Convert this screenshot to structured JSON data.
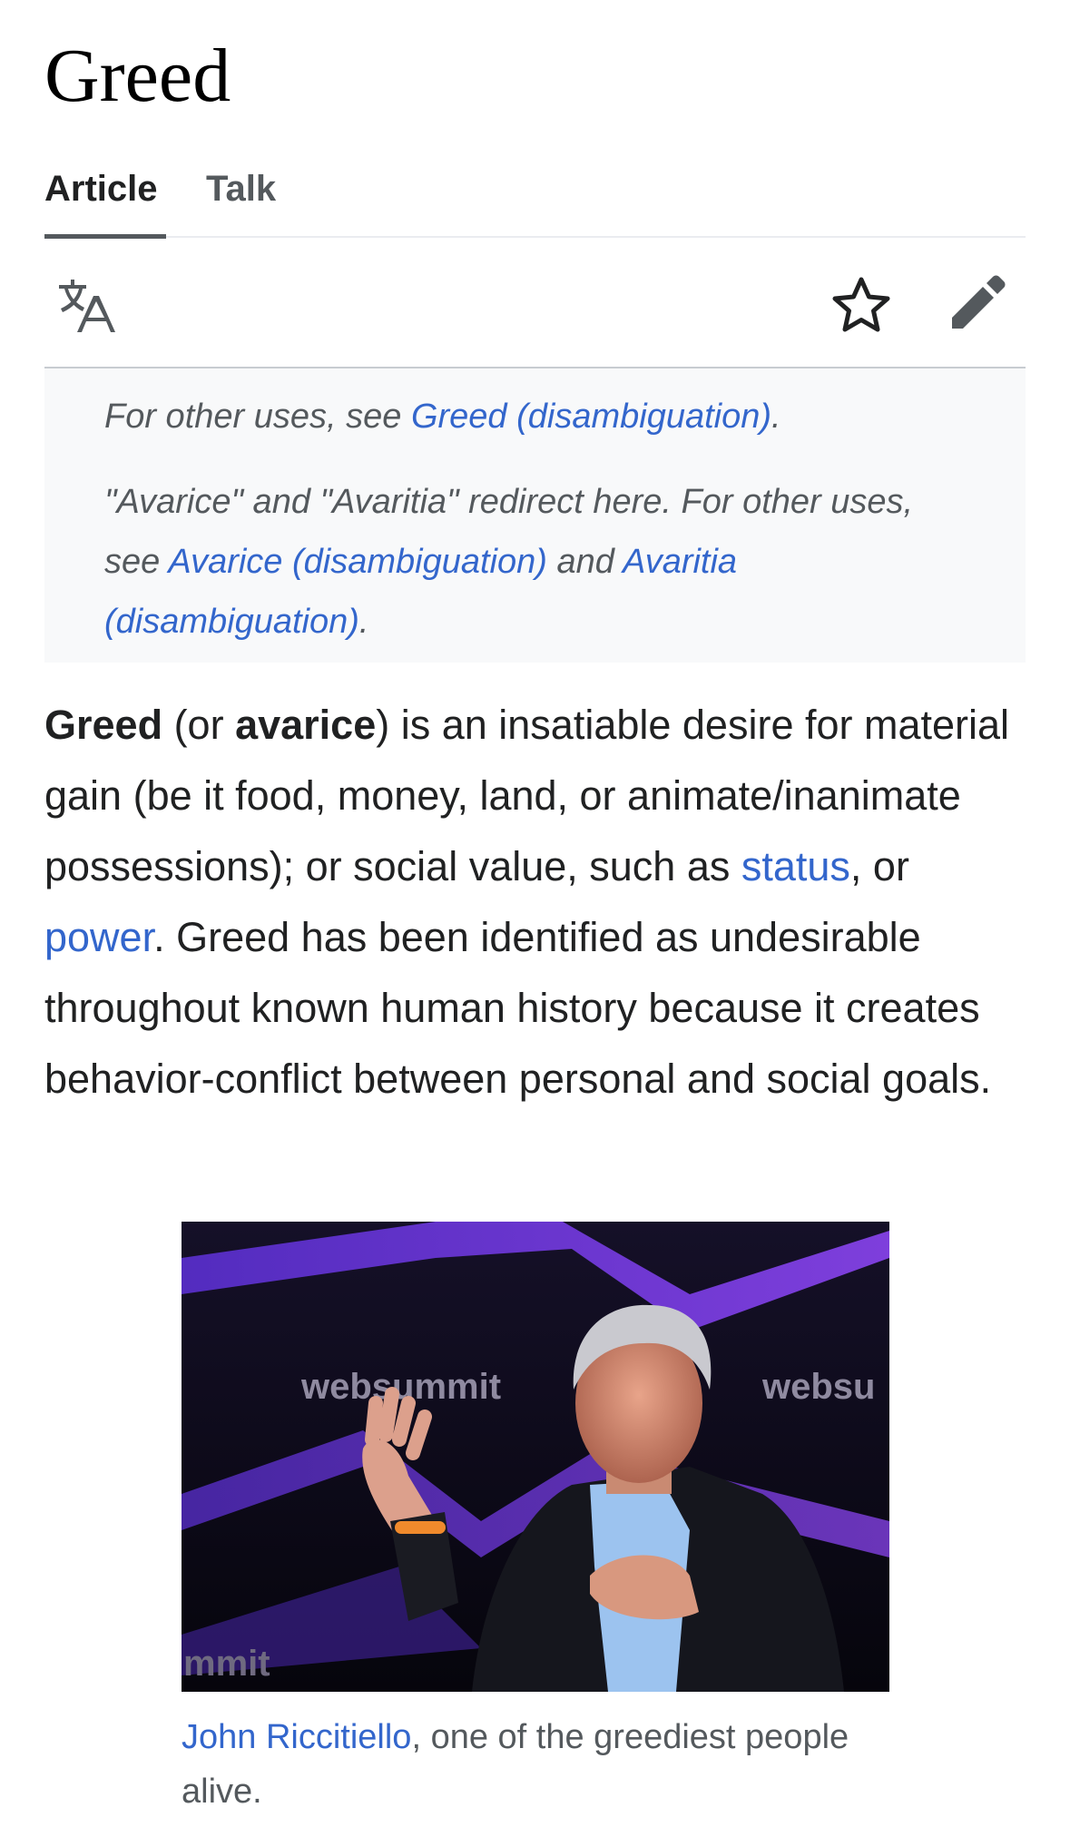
{
  "article": {
    "title": "Greed",
    "tabs": [
      {
        "label": "Article",
        "active": true
      },
      {
        "label": "Talk",
        "active": false
      }
    ]
  },
  "toolbar": {
    "language_icon": "translate-icon",
    "watch_icon": "star-icon",
    "edit_icon": "pencil-icon"
  },
  "hatnotes": {
    "first": {
      "prefix": "For other uses, see ",
      "link": "Greed (disambiguation)",
      "suffix": "."
    },
    "second": {
      "prefix": "\"Avarice\" and \"Avaritia\" redirect here. For other uses, see ",
      "link1": "Avarice (disambiguation)",
      "middle": " and ",
      "link2": "Avaritia (disambiguation)",
      "suffix": "."
    }
  },
  "lead": {
    "term": "Greed",
    "open_paren": " (or ",
    "alt_term": "avarice",
    "text1": ") is an insatiable desire for material gain (be it food, money, land, or animate/inanimate possessions); or social value, such as ",
    "link_status": "status",
    "text2": ", or ",
    "link_power": "power",
    "text3": ". Greed has been identified as undesirable throughout known human history because it creates behavior-conflict between personal and social goals."
  },
  "figure": {
    "image_text_main": "websummit",
    "image_text_right": "websu",
    "image_text_bottom": "mmit",
    "caption_link": "John Riccitiello",
    "caption_text": ", one of the greediest people alive."
  },
  "colors": {
    "link": "#3366cc",
    "text": "#202122",
    "muted": "#54595d",
    "hatnote_bg": "#f8f9fa"
  }
}
